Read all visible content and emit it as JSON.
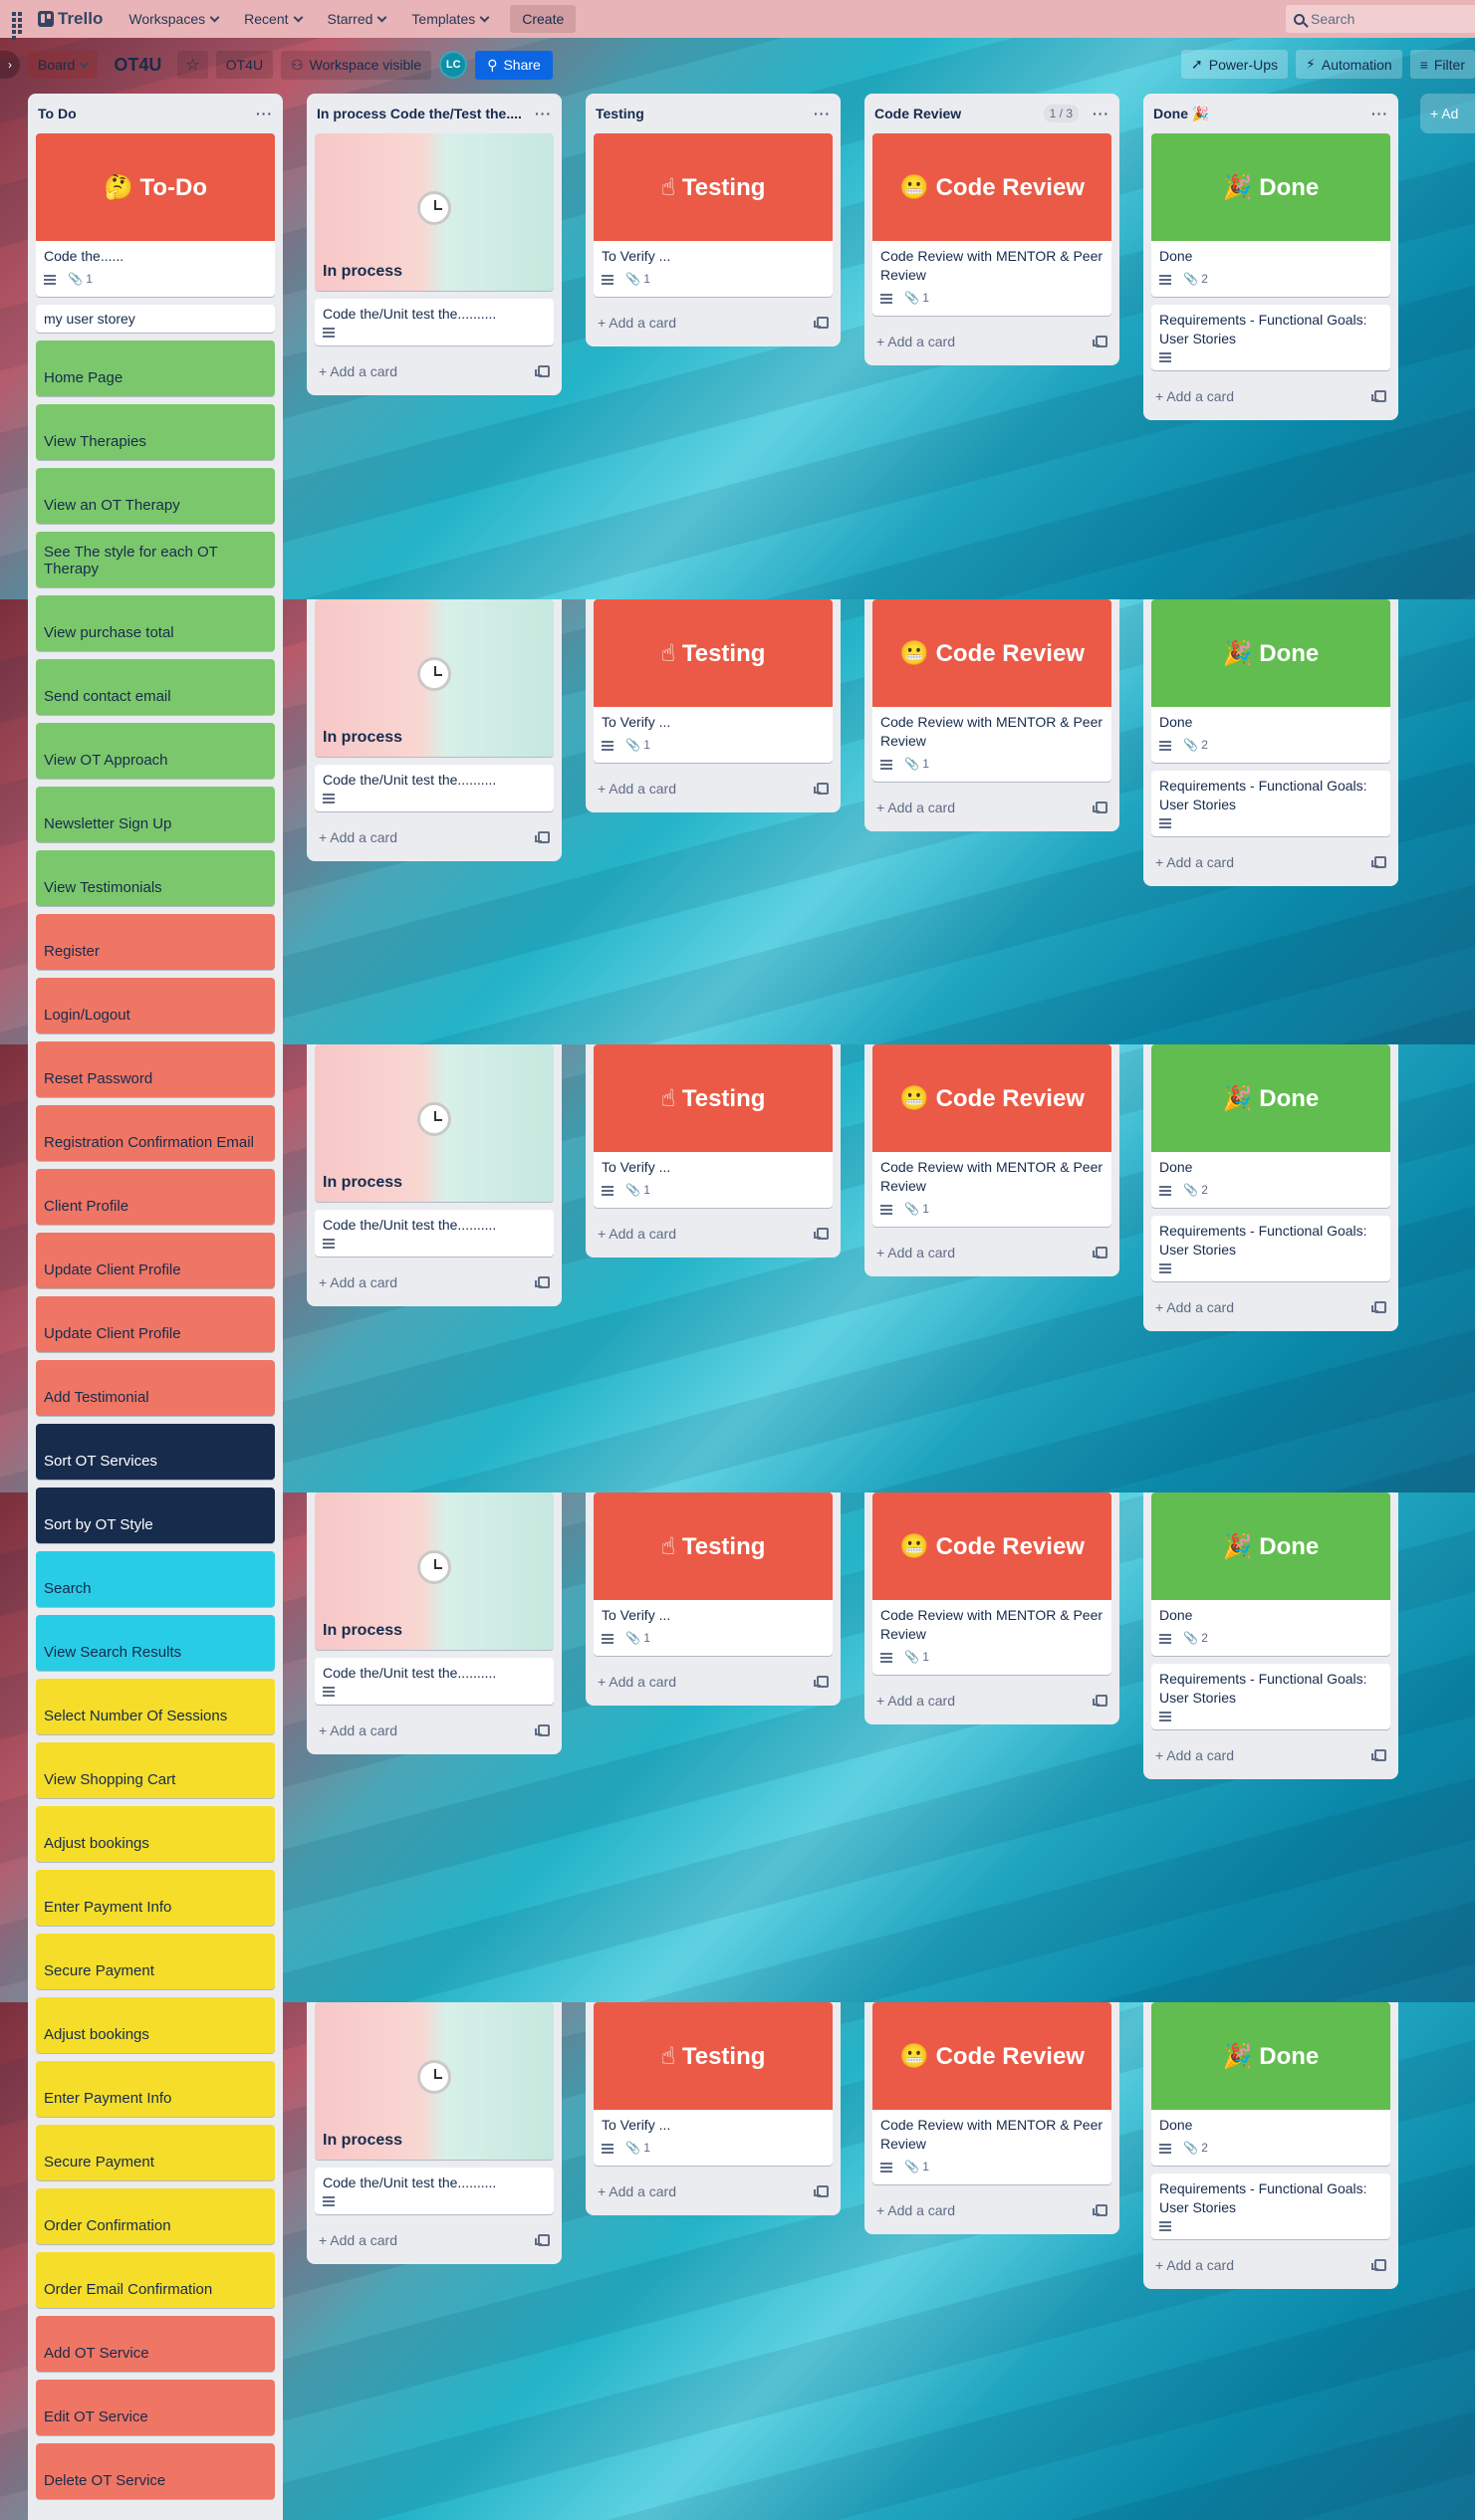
{
  "topbar": {
    "logo": "Trello",
    "nav": [
      "Workspaces",
      "Recent",
      "Starred",
      "Templates"
    ],
    "create": "Create",
    "search_placeholder": "Search"
  },
  "boardbar": {
    "view": "Board",
    "title": "OT4U",
    "workspace": "OT4U",
    "visibility": "Workspace visible",
    "avatar": "LC",
    "share": "Share",
    "powerups": "Power-Ups",
    "automation": "Automation",
    "filter": "Filter",
    "add_list": "+ Ad"
  },
  "lists": {
    "todo": {
      "title": "To Do",
      "cover": "🤔 To-Do",
      "first_card": "Code the......",
      "first_card_attachments": "1",
      "user_story": "my user storey",
      "cards": [
        {
          "text": "Home Page",
          "color": "green"
        },
        {
          "text": "View Therapies",
          "color": "green"
        },
        {
          "text": "View an OT Therapy",
          "color": "green"
        },
        {
          "text": "See The style for each OT Therapy",
          "color": "green"
        },
        {
          "text": "View purchase total",
          "color": "green"
        },
        {
          "text": "Send contact email",
          "color": "green"
        },
        {
          "text": "View OT Approach",
          "color": "green"
        },
        {
          "text": "Newsletter Sign Up",
          "color": "green"
        },
        {
          "text": "View Testimonials",
          "color": "green"
        },
        {
          "text": "Register",
          "color": "red"
        },
        {
          "text": "Login/Logout",
          "color": "red"
        },
        {
          "text": "Reset Password",
          "color": "red"
        },
        {
          "text": "Registration Confirmation Email",
          "color": "red"
        },
        {
          "text": "Client Profile",
          "color": "red"
        },
        {
          "text": "Update Client Profile",
          "color": "red"
        },
        {
          "text": "Update Client Profile",
          "color": "red"
        },
        {
          "text": "Add Testimonial",
          "color": "red"
        },
        {
          "text": "Sort OT Services",
          "color": "navy"
        },
        {
          "text": "Sort by OT Style",
          "color": "navy"
        },
        {
          "text": "Search",
          "color": "cyan"
        },
        {
          "text": "View Search Results",
          "color": "cyan"
        },
        {
          "text": "Select Number Of Sessions",
          "color": "yellow"
        },
        {
          "text": "View Shopping Cart",
          "color": "yellow"
        },
        {
          "text": "Adjust bookings",
          "color": "yellow"
        },
        {
          "text": "Enter Payment Info",
          "color": "yellow"
        },
        {
          "text": "Secure Payment",
          "color": "yellow"
        },
        {
          "text": "Adjust bookings",
          "color": "yellow"
        },
        {
          "text": "Enter Payment Info",
          "color": "yellow"
        },
        {
          "text": "Secure Payment",
          "color": "yellow"
        },
        {
          "text": "Order Confirmation",
          "color": "yellow"
        },
        {
          "text": "Order Email Confirmation",
          "color": "yellow"
        },
        {
          "text": "Add OT Service",
          "color": "red"
        },
        {
          "text": "Edit OT Service",
          "color": "red"
        },
        {
          "text": "Delete OT Service",
          "color": "red"
        }
      ]
    },
    "inprocess": {
      "title": "In process Code the/Test the....",
      "cover_label": "In process",
      "card": "Code the/Unit test the..........",
      "add": "Add a card"
    },
    "testing": {
      "title": "Testing",
      "cover": "☝ Testing",
      "card": "To Verify ...",
      "attachments": "1",
      "add": "Add a card"
    },
    "review": {
      "title": "Code Review",
      "count": "1 / 3",
      "cover": "😬 Code Review",
      "card": "Code Review with MENTOR & Peer Review",
      "attachments": "1",
      "add": "Add a card"
    },
    "done": {
      "title": "Done 🎉",
      "cover": "🎉 Done",
      "card": "Done",
      "attachments": "2",
      "card2": "Requirements - Functional Goals: User Stories",
      "add": "Add a card"
    }
  },
  "colors": {
    "green": "#7bc86c",
    "red": "#ef7564",
    "navy": "#172b4d",
    "cyan": "#29cce5",
    "yellow": "#f5dd29",
    "cover_red": "#eb5a46",
    "cover_green": "#61bd4f",
    "share_blue": "#0c66e4"
  }
}
